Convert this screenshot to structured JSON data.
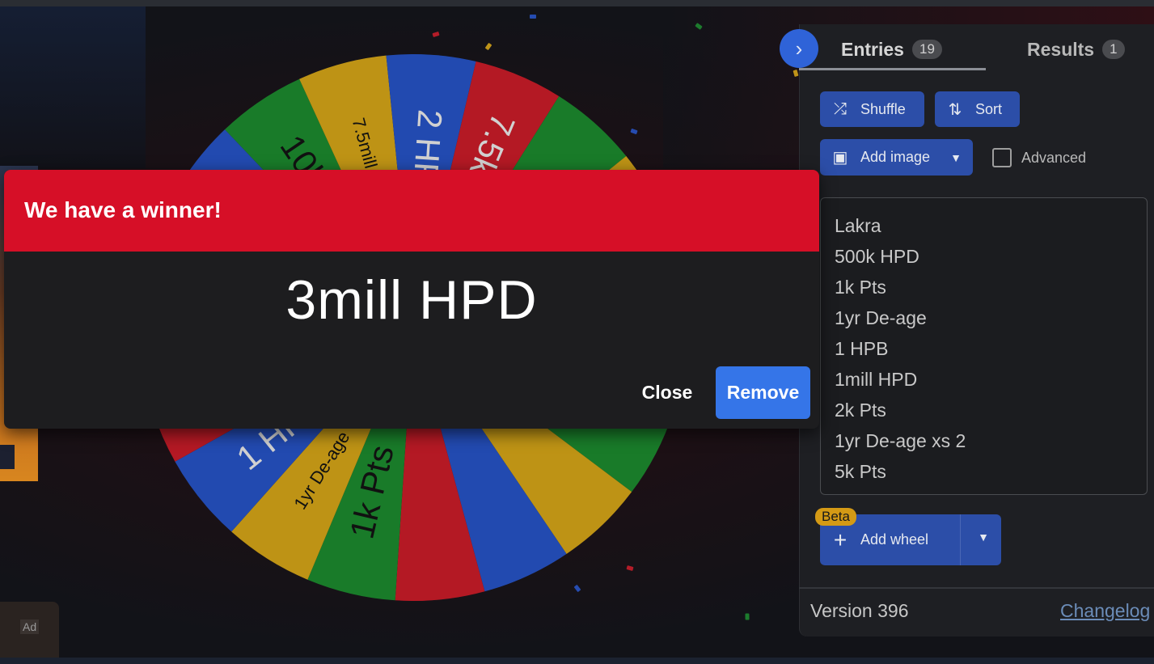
{
  "dialog": {
    "title": "We have a winner!",
    "winner": "3mill HPD",
    "close_label": "Close",
    "remove_label": "Remove"
  },
  "tabs": {
    "entries_label": "Entries",
    "entries_count": "19",
    "results_label": "Results",
    "results_count": "1"
  },
  "toolbar": {
    "shuffle_label": "Shuffle",
    "sort_label": "Sort",
    "add_image_label": "Add image",
    "advanced_label": "Advanced"
  },
  "entries": [
    "Lakra",
    "500k HPD",
    "1k Pts",
    "1yr De-age",
    "1 HPB",
    "1mill HPD",
    "2k Pts",
    "1yr De-age xs 2",
    "5k Pts"
  ],
  "add_wheel": {
    "beta_label": "Beta",
    "label": "Add wheel"
  },
  "footer": {
    "version": "Version 396",
    "changelog": "Changelog"
  },
  "ad": {
    "label": "Ad"
  },
  "wheel": {
    "colors": [
      "#1f9633",
      "#e8b41a",
      "#2a5bd7",
      "#dc1f2d"
    ],
    "visible_labels": [
      "7.5mill HPD",
      "2 HPB",
      "7.5k Pts",
      "3mill HPD",
      "10k Pts",
      "1k Pts",
      "1yr De-age",
      "1 HPB",
      "1mill HPD",
      "2k Pts",
      "1yr De-age xs 2",
      "Pts"
    ]
  }
}
